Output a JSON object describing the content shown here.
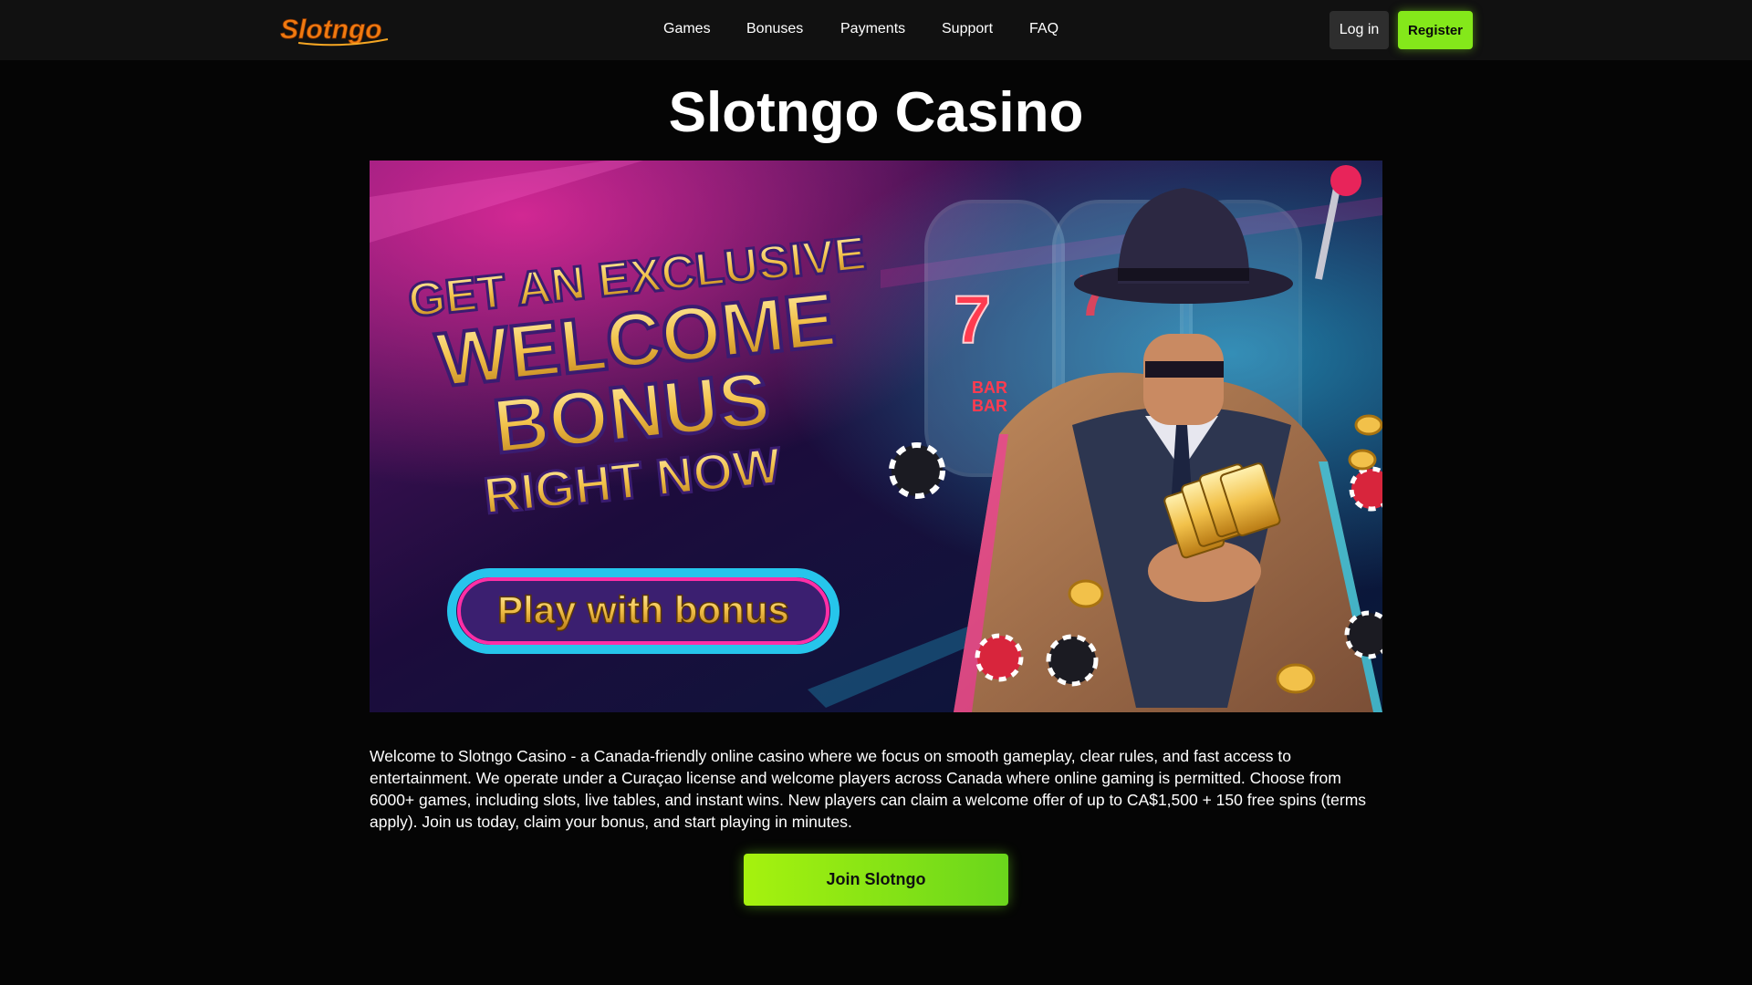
{
  "header": {
    "logo_text": "Slotngo",
    "nav": {
      "games": "Games",
      "bonuses": "Bonuses",
      "payments": "Payments",
      "support": "Support",
      "faq": "FAQ"
    },
    "login_label": "Log in",
    "register_label": "Register"
  },
  "main": {
    "title": "Slotngo Casino",
    "banner": {
      "line1": "GET AN EXCLUSIVE",
      "line2": "WELCOME",
      "line3": "BONUS",
      "line4": "RIGHT NOW",
      "cta_label": "Play with bonus",
      "reel_symbols": [
        "7",
        "7",
        "BAR",
        "BAR"
      ]
    },
    "intro_text": "Welcome to Slotngo Casino - a Canada-friendly online casino where we focus on smooth gameplay, clear rules, and fast access to entertainment. We operate under a Curaçao license and welcome players across Canada where online gaming is permitted. Choose from 6000+ games, including slots, live tables, and instant wins. New players can claim a welcome offer of up to CA$1,500 + 150 free spins (terms apply). Join us today, claim your bonus, and start playing in minutes.",
    "join_label": "Join Slotngo"
  },
  "colors": {
    "background": "#050505",
    "header_bg": "#111111",
    "accent_green": "#84e81a",
    "logo_orange": "#f07a10",
    "banner_gold": "#f2c14a",
    "banner_pink": "#ff2fa6",
    "banner_cyan": "#28d9ff"
  }
}
